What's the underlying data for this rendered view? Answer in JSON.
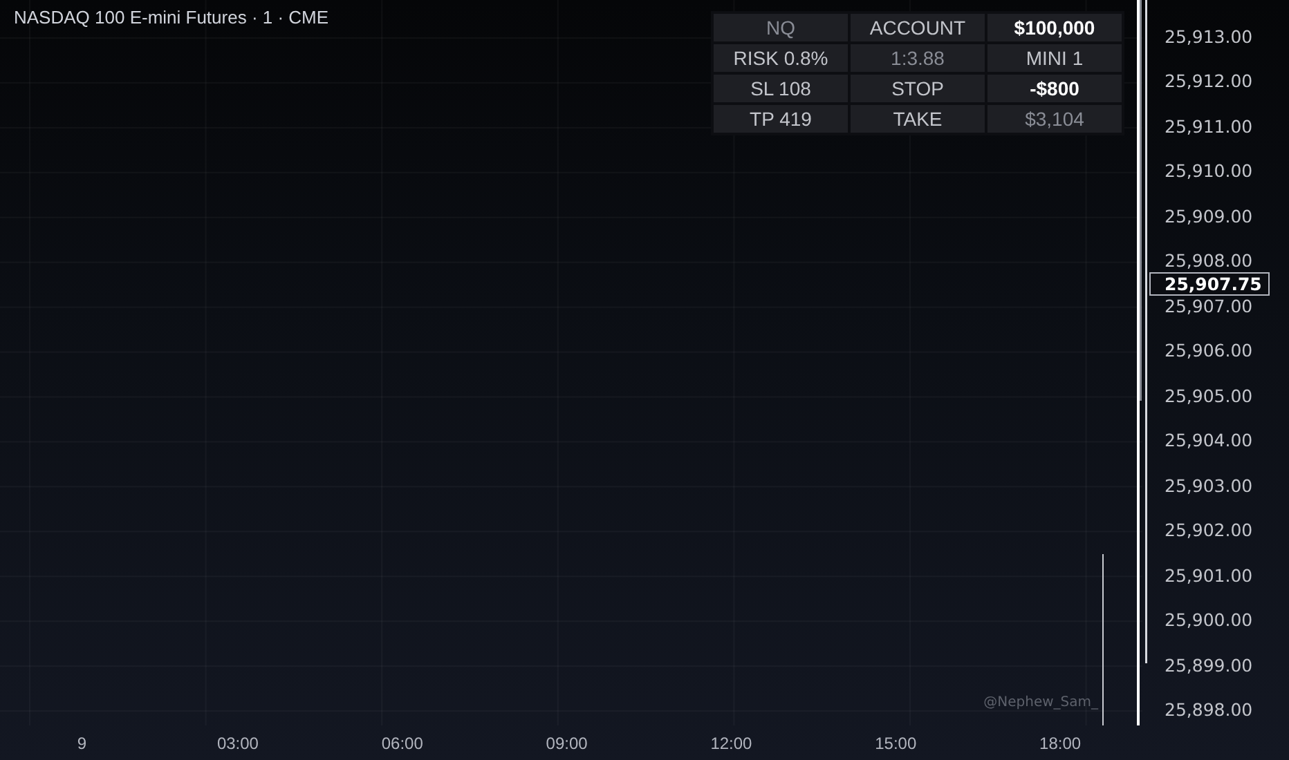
{
  "chart": {
    "title": "NASDAQ 100 E-mini Futures · 1 · CME",
    "credit": "@Nephew_Sam_",
    "info_table": [
      [
        {
          "text": "NQ",
          "bold": false,
          "muted": true
        },
        {
          "text": "ACCOUNT",
          "bold": false,
          "muted": false
        },
        {
          "text": "$100,000",
          "bold": true,
          "muted": false
        }
      ],
      [
        {
          "text": "RISK 0.8%",
          "bold": false,
          "muted": false
        },
        {
          "text": "1:3.88",
          "bold": false,
          "muted": true
        },
        {
          "text": "MINI 1",
          "bold": false,
          "muted": false
        }
      ],
      [
        {
          "text": "SL 108",
          "bold": false,
          "muted": false
        },
        {
          "text": "STOP",
          "bold": false,
          "muted": false
        },
        {
          "text": "-$800",
          "bold": true,
          "muted": false
        }
      ],
      [
        {
          "text": "TP 419",
          "bold": false,
          "muted": false
        },
        {
          "text": "TAKE",
          "bold": false,
          "muted": false
        },
        {
          "text": "$3,104",
          "bold": false,
          "muted": true
        }
      ]
    ]
  },
  "price_axis": {
    "labels": [
      "25,913.00",
      "25,912.00",
      "25,911.00",
      "25,910.00",
      "25,909.00",
      "25,908.00",
      "25,907.00",
      "25,906.00",
      "25,905.00",
      "25,904.00",
      "25,903.00",
      "25,902.00",
      "25,901.00",
      "25,900.00",
      "25,899.00",
      "25,898.00"
    ],
    "current_price": "25,907.75"
  },
  "time_axis": {
    "labels": [
      "9",
      "03:00",
      "06:00",
      "09:00",
      "12:00",
      "15:00",
      "18:00"
    ]
  }
}
